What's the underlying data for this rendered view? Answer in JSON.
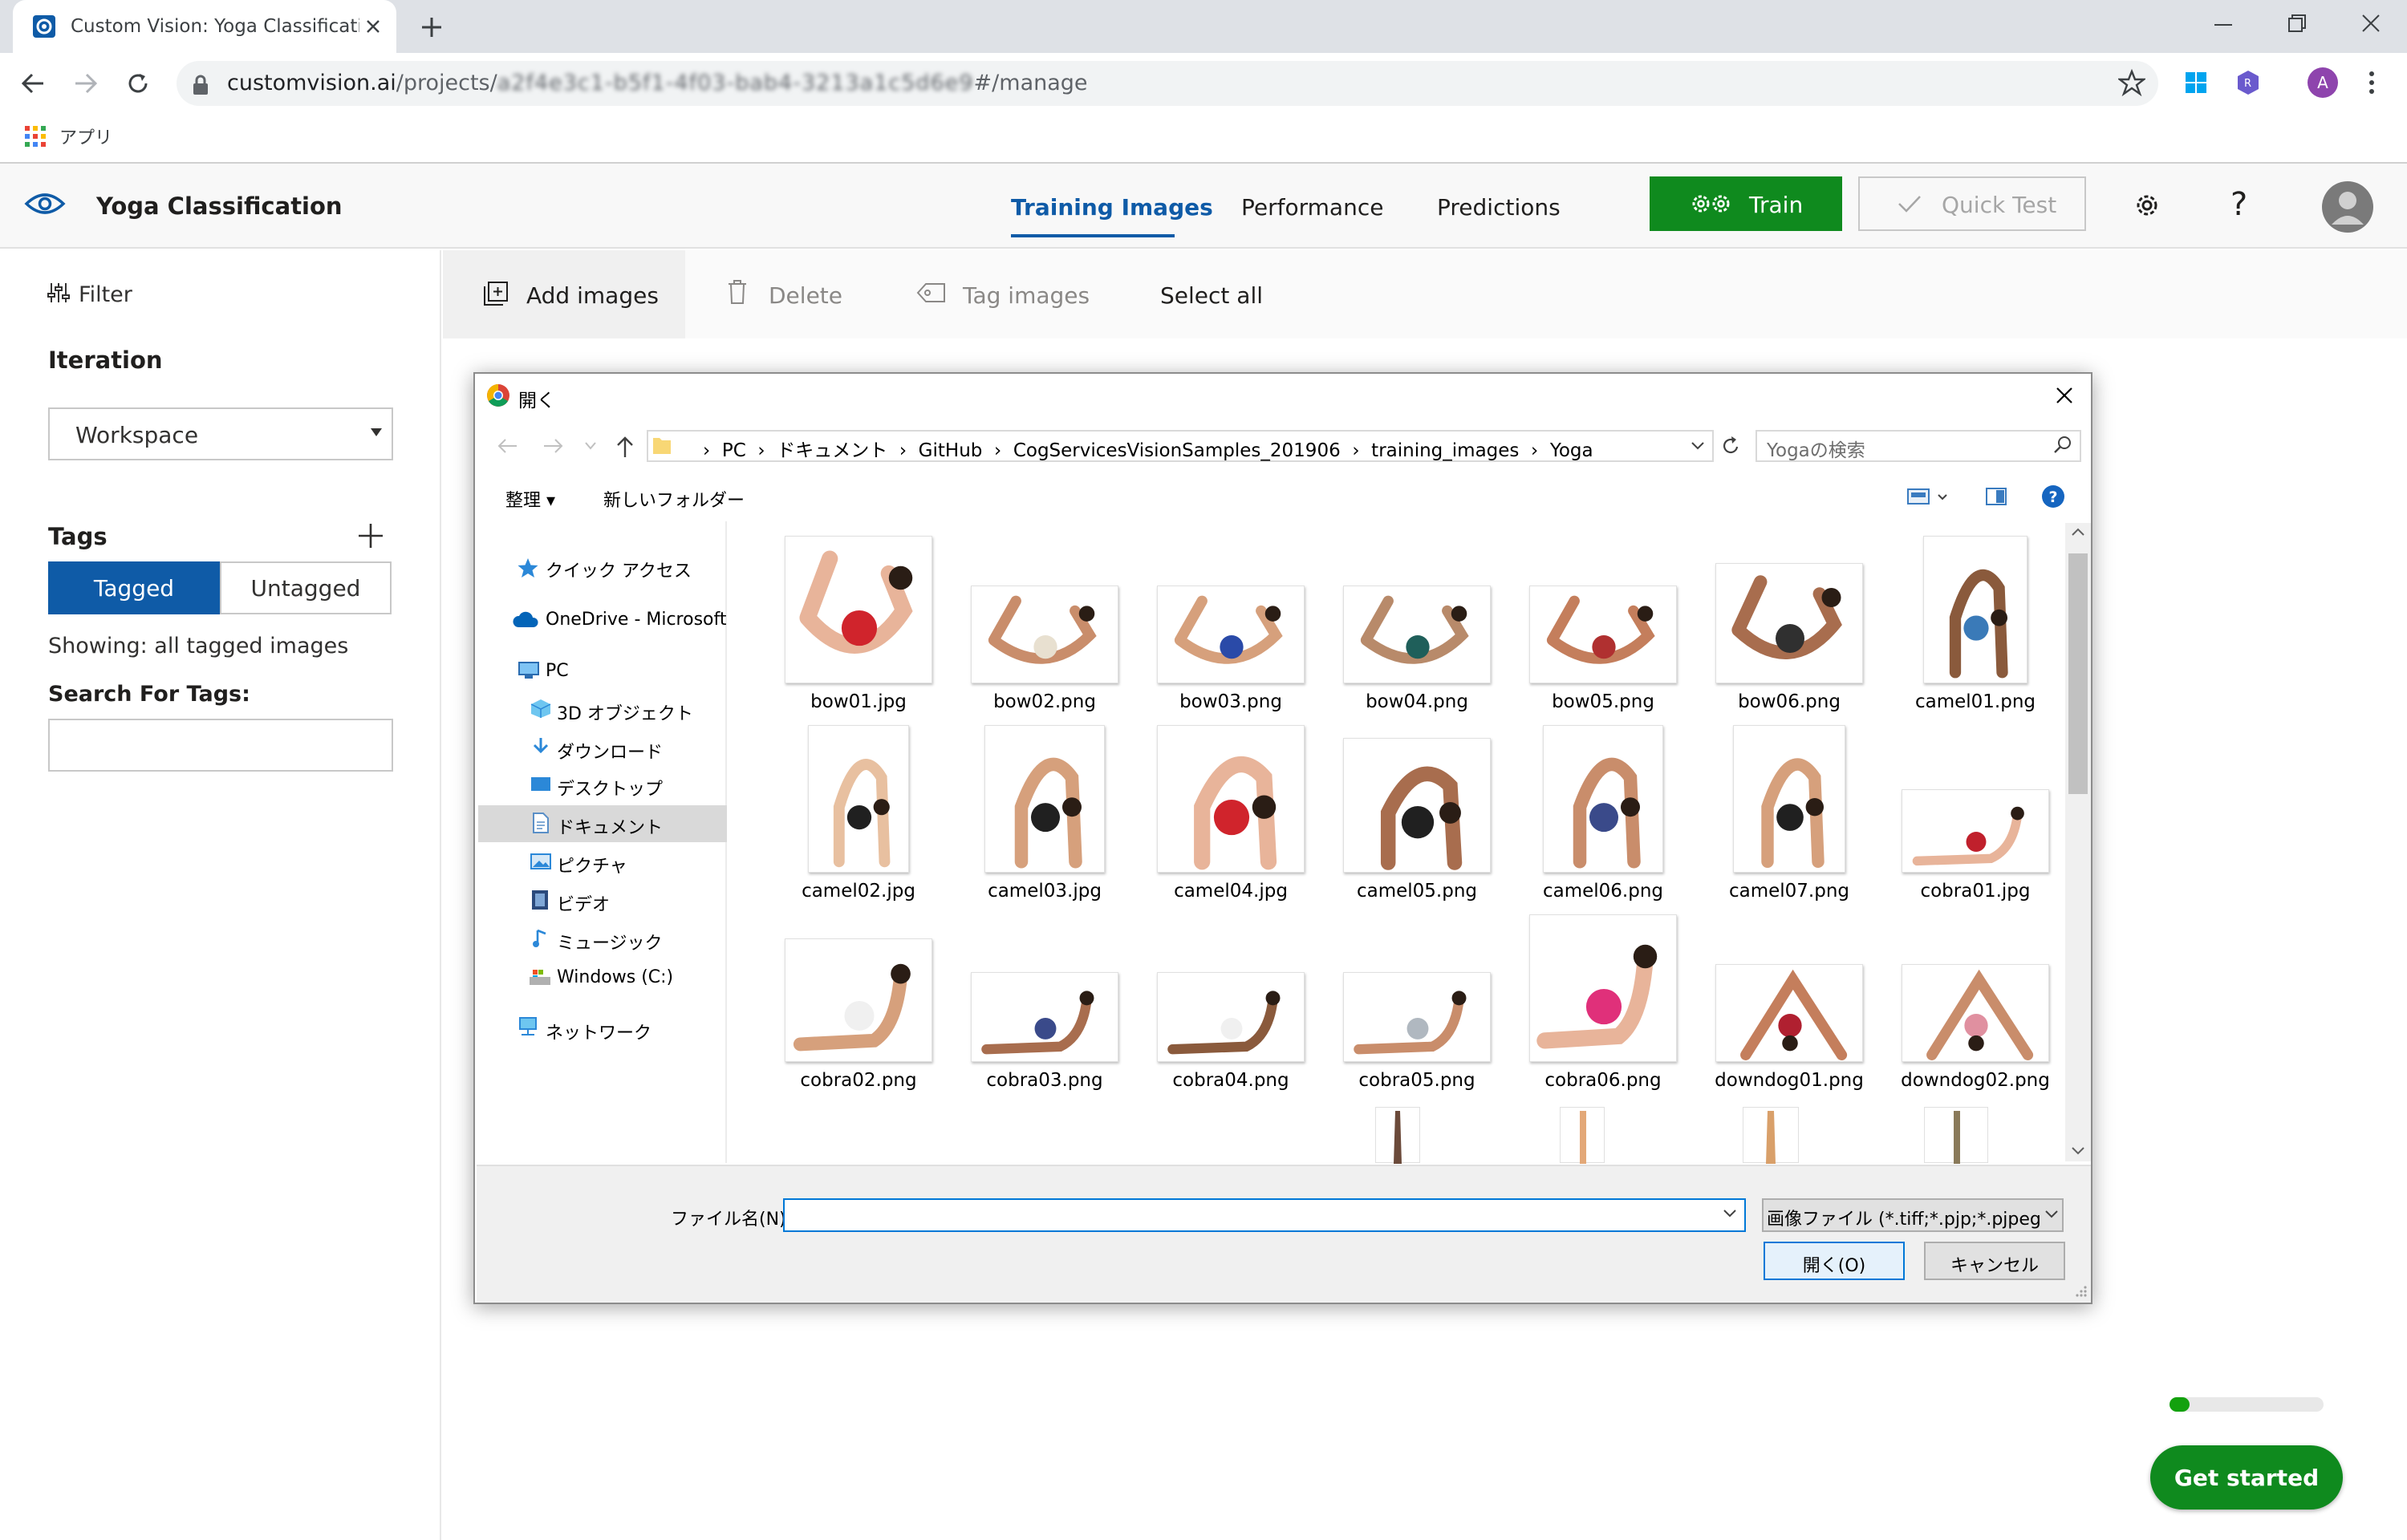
{
  "browser": {
    "tab_title": "Custom Vision: Yoga Classification",
    "url_host": "customvision.ai",
    "url_path": "/projects/",
    "url_masked": "a2f4e3c1-b5f1-4f03-bab4-3213a1c5d6e9",
    "url_fragment": "#/manage",
    "apps_label": "アプリ",
    "profile_initial": "A"
  },
  "header": {
    "project_name": "Yoga Classification",
    "nav": {
      "training_images": "Training Images",
      "performance": "Performance",
      "predictions": "Predictions"
    },
    "train_label": "Train",
    "quick_test_label": "Quick Test",
    "help_label": "?"
  },
  "sidebar": {
    "filter_label": "Filter",
    "iteration_heading": "Iteration",
    "iteration_value": "Workspace",
    "tags_heading": "Tags",
    "tagged_label": "Tagged",
    "untagged_label": "Untagged",
    "showing_text": "Showing: all tagged images",
    "search_tags_heading": "Search For Tags:",
    "search_tags_value": ""
  },
  "command_bar": {
    "add_images": "Add images",
    "delete": "Delete",
    "tag_images": "Tag images",
    "select_all": "Select all"
  },
  "dialog": {
    "title": "開く",
    "path": [
      "PC",
      "ドキュメント",
      "GitHub",
      "CogServicesVisionSamples_201906",
      "training_images",
      "Yoga"
    ],
    "search_placeholder": "Yogaの検索",
    "organize": "整理 ▾",
    "new_folder": "新しいフォルダー",
    "nav_items": [
      {
        "label": "クイック アクセス",
        "icon": "star-icon"
      },
      {
        "label": "OneDrive - Microsoft",
        "icon": "cloud-icon"
      },
      {
        "label": "PC",
        "icon": "pc-icon"
      },
      {
        "label": "3D オブジェクト",
        "icon": "cube-icon"
      },
      {
        "label": "ダウンロード",
        "icon": "download-icon"
      },
      {
        "label": "デスクトップ",
        "icon": "desktop-icon"
      },
      {
        "label": "ドキュメント",
        "icon": "document-icon"
      },
      {
        "label": "ピクチャ",
        "icon": "picture-icon"
      },
      {
        "label": "ビデオ",
        "icon": "video-icon"
      },
      {
        "label": "ミュージック",
        "icon": "music-icon"
      },
      {
        "label": "Windows (C:)",
        "icon": "drive-icon"
      },
      {
        "label": "ネットワーク",
        "icon": "network-icon"
      }
    ],
    "files": [
      "bow01.jpg",
      "bow02.png",
      "bow03.png",
      "bow04.png",
      "bow05.png",
      "bow06.png",
      "camel01.png",
      "camel02.jpg",
      "camel03.jpg",
      "camel04.jpg",
      "camel05.png",
      "camel06.png",
      "camel07.png",
      "cobra01.jpg",
      "cobra02.png",
      "cobra03.png",
      "cobra04.png",
      "cobra05.png",
      "cobra06.png",
      "downdog01.png",
      "downdog02.png"
    ],
    "filename_label": "ファイル名(N):",
    "filename_value": "",
    "filetype_label": "画像ファイル (*.tiff;*.pjp;*.pjpeg;*.j",
    "open_label": "開く(O)",
    "cancel_label": "キャンセル"
  },
  "footer": {
    "get_started": "Get started",
    "progress_fraction": 0.13
  },
  "colors": {
    "accent": "#0f5ba7",
    "train_green": "#0f8a1e",
    "progress_green": "#13a10e"
  }
}
